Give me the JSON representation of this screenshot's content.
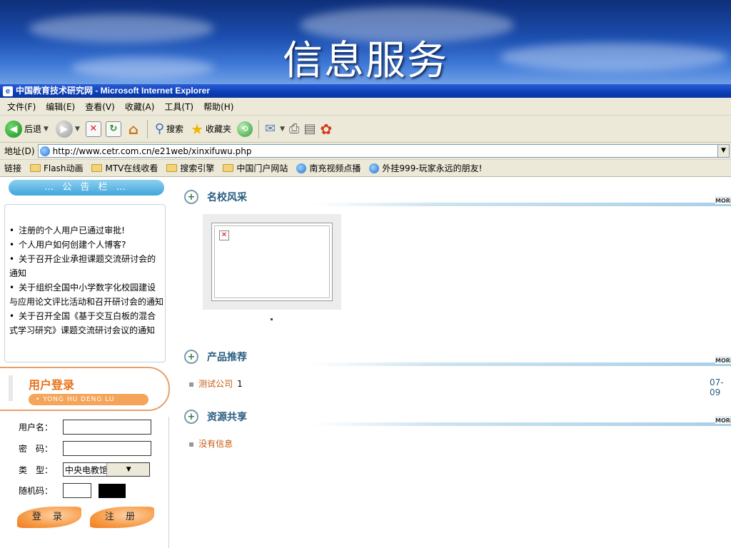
{
  "slide": {
    "title": "信息服务"
  },
  "window": {
    "title": "中国教育技术研究网 - Microsoft Internet Explorer"
  },
  "menu": {
    "items": [
      "文件(F)",
      "编辑(E)",
      "查看(V)",
      "收藏(A)",
      "工具(T)",
      "帮助(H)"
    ]
  },
  "toolbar": {
    "back_label": "后退",
    "search_label": "搜索",
    "favorites_label": "收藏夹"
  },
  "address": {
    "label": "地址(D)",
    "url": "http://www.cetr.com.cn/e21web/xinxifuwu.php"
  },
  "links": {
    "label": "链接",
    "items": [
      "Flash动画",
      "MTV在线收看",
      "搜索引擎",
      "中国门户网站",
      "南充视频点播",
      "外挂999-玩家永远的朋友!"
    ]
  },
  "notice": {
    "tab_label": "… 公 告 栏 …",
    "items": [
      "注册的个人用户已通过审批!",
      "个人用户如何创建个人博客?",
      "关于召开企业承担课题交流研讨会的通知",
      "关于组织全国中小学数字化校园建设与应用论文评比活动和召开研讨会的通知",
      "关于召开全国《基于交互白板的混合式学习研究》课题交流研讨会议的通知"
    ]
  },
  "login": {
    "title": "用户登录",
    "subtitle": "• YONG HU DENG LU",
    "username_label": "用户名：",
    "password_label": "密　码：",
    "type_label": "类　型：",
    "type_value": "中央电教馆研究室",
    "captcha_label": "随机码：",
    "login_button": "登 录",
    "register_button": "注 册"
  },
  "sections": {
    "schools": {
      "title": "名校风采",
      "more": "MORE"
    },
    "products": {
      "title": "产品推荐",
      "more": "MORE",
      "item_name": "测试公司",
      "item_count": "1",
      "item_date": "07-09"
    },
    "resources": {
      "title": "资源共享",
      "more": "MORE",
      "empty_text": "没有信息"
    }
  }
}
